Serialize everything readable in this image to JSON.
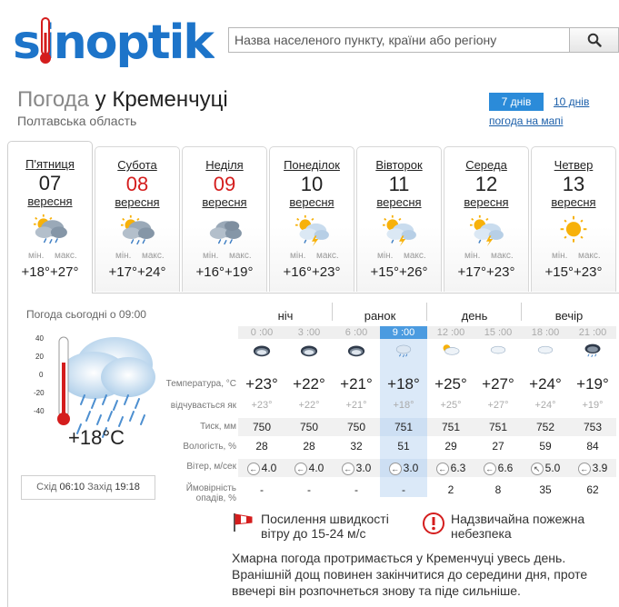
{
  "header": {
    "logo_text": "sinoptik",
    "search_placeholder": "Назва населеного пункту, країни або регіону",
    "search_icon": "search-icon"
  },
  "title": {
    "prefix": "Погода",
    "city": "у Кременчуці",
    "region": "Полтавська область"
  },
  "view_tabs": {
    "days7": "7 днів",
    "days10": "10 днів",
    "map_link": "погода на мапі"
  },
  "days": [
    {
      "name": "П'ятниця",
      "num": "07",
      "month": "вересня",
      "min_label": "мін.",
      "max_label": "макс.",
      "min": "+18°",
      "max": "+27°",
      "icon": "partly-cloudy-rain-icon",
      "red": false
    },
    {
      "name": "Субота",
      "num": "08",
      "month": "вересня",
      "min_label": "мін.",
      "max_label": "макс.",
      "min": "+17°",
      "max": "+24°",
      "icon": "partly-cloudy-rain-icon",
      "red": true
    },
    {
      "name": "Неділя",
      "num": "09",
      "month": "вересня",
      "min_label": "мін.",
      "max_label": "макс.",
      "min": "+16°",
      "max": "+19°",
      "icon": "cloudy-rain-icon",
      "red": true
    },
    {
      "name": "Понеділок",
      "num": "10",
      "month": "вересня",
      "min_label": "мін.",
      "max_label": "макс.",
      "min": "+16°",
      "max": "+23°",
      "icon": "partly-cloudy-thunder-icon",
      "red": false
    },
    {
      "name": "Вівторок",
      "num": "11",
      "month": "вересня",
      "min_label": "мін.",
      "max_label": "макс.",
      "min": "+15°",
      "max": "+26°",
      "icon": "partly-cloudy-thunder-icon",
      "red": false
    },
    {
      "name": "Середа",
      "num": "12",
      "month": "вересня",
      "min_label": "мін.",
      "max_label": "макс.",
      "min": "+17°",
      "max": "+23°",
      "icon": "partly-cloudy-thunder-icon",
      "red": false
    },
    {
      "name": "Четвер",
      "num": "13",
      "month": "вересня",
      "min_label": "мін.",
      "max_label": "макс.",
      "min": "+15°",
      "max": "+23°",
      "icon": "sunny-icon",
      "red": false
    }
  ],
  "today": {
    "label": "Погода сьогодні о 09:00",
    "current_temp": "+18°C",
    "scale": [
      "40",
      "20",
      "0",
      "-20",
      "-40"
    ],
    "sunrise_label": "Схід",
    "sunrise": "06:10",
    "sunset_label": "Захід",
    "sunset": "19:18"
  },
  "periods": [
    "ніч",
    "ранок",
    "день",
    "вечір"
  ],
  "row_labels": {
    "temp": "Температура, °C",
    "feels": "відчувається як",
    "pressure": "Тиск, мм",
    "humidity": "Вологість, %",
    "wind": "Вітер, м/сек",
    "precip1": "Ймовірність",
    "precip2": "опадів, %"
  },
  "hours": [
    {
      "time": "0 :00",
      "temp": "+23°",
      "feels": "+23°",
      "pressure": "750",
      "humidity": "28",
      "wind_dir": "←",
      "wind": "4.0",
      "precip": "-",
      "icon": "cloudy-night-icon"
    },
    {
      "time": "3 :00",
      "temp": "+22°",
      "feels": "+22°",
      "pressure": "750",
      "humidity": "28",
      "wind_dir": "←",
      "wind": "4.0",
      "precip": "-",
      "icon": "cloudy-night-icon"
    },
    {
      "time": "6 :00",
      "temp": "+21°",
      "feels": "+21°",
      "pressure": "750",
      "humidity": "32",
      "wind_dir": "←",
      "wind": "3.0",
      "precip": "-",
      "icon": "cloudy-night-icon"
    },
    {
      "time": "9 :00",
      "temp": "+18°",
      "feels": "+18°",
      "pressure": "751",
      "humidity": "51",
      "wind_dir": "←",
      "wind": "3.0",
      "precip": "-",
      "icon": "cloud-rain-icon"
    },
    {
      "time": "12 :00",
      "temp": "+25°",
      "feels": "+25°",
      "pressure": "751",
      "humidity": "29",
      "wind_dir": "←",
      "wind": "6.3",
      "precip": "2",
      "icon": "partly-cloudy-icon"
    },
    {
      "time": "15 :00",
      "temp": "+27°",
      "feels": "+27°",
      "pressure": "751",
      "humidity": "27",
      "wind_dir": "←",
      "wind": "6.6",
      "precip": "8",
      "icon": "cloud-icon"
    },
    {
      "time": "18 :00",
      "temp": "+24°",
      "feels": "+24°",
      "pressure": "752",
      "humidity": "59",
      "wind_dir": "↖",
      "wind": "5.0",
      "precip": "35",
      "icon": "cloud-icon"
    },
    {
      "time": "21 :00",
      "temp": "+19°",
      "feels": "+19°",
      "pressure": "753",
      "humidity": "84",
      "wind_dir": "←",
      "wind": "3.9",
      "precip": "62",
      "icon": "cloudy-night-rain-icon"
    }
  ],
  "warnings": {
    "wind": "Посилення швидкості вітру до 15-24 м/с",
    "fire": "Надзвичайна пожежна небезпека"
  },
  "description": "Хмарна погода протримається у Кременчуці увесь день. Вранішній дощ повинен закінчитися до середини дня, проте ввечері він розпочнеться знову та піде сильніше.",
  "colors": {
    "brand": "#1d74c9",
    "red": "#d41d1d",
    "active_hour": "#4b9be0"
  }
}
